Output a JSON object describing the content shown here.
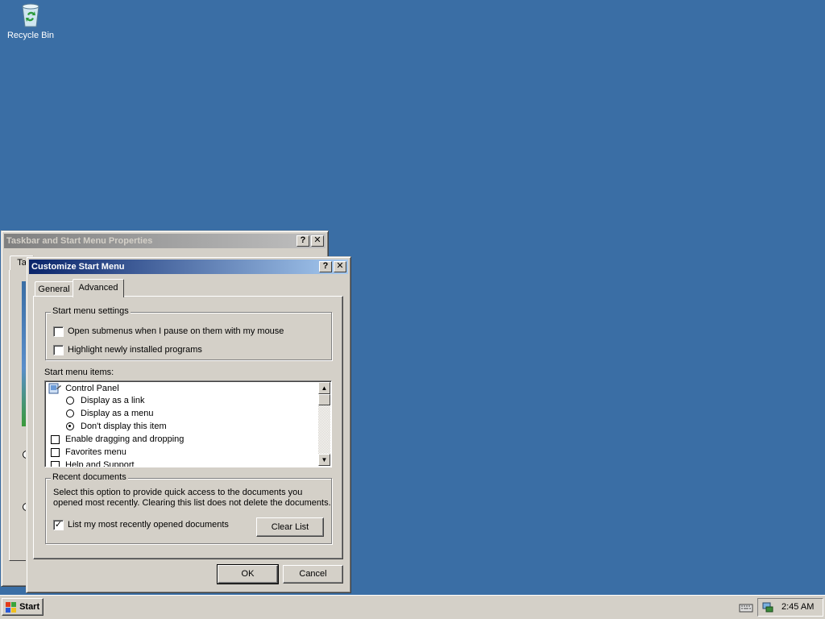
{
  "desktop": {
    "icons": [
      {
        "label": "Recycle Bin",
        "icon": "recycle-bin-icon"
      }
    ],
    "background_color": "#3a6ea5"
  },
  "back_window": {
    "title": "Taskbar and Start Menu Properties",
    "tab_partial": "Ta"
  },
  "dialog": {
    "title": "Customize Start Menu",
    "help_button": "?",
    "close_button": "✕",
    "tabs": [
      {
        "label": "General",
        "selected": false
      },
      {
        "label": "Advanced",
        "selected": true
      }
    ],
    "start_menu_settings": {
      "legend": "Start menu settings",
      "options": [
        {
          "label": "Open submenus when I pause on them with my mouse",
          "checked": false
        },
        {
          "label": "Highlight newly installed programs",
          "checked": false
        }
      ]
    },
    "start_menu_items": {
      "label": "Start menu items:",
      "items": [
        {
          "type": "header",
          "label": "Control Panel",
          "icon": "control-panel-icon"
        },
        {
          "type": "radio",
          "label": "Display as a link",
          "selected": false
        },
        {
          "type": "radio",
          "label": "Display as a menu",
          "selected": false
        },
        {
          "type": "radio",
          "label": "Don't display this item",
          "selected": true
        },
        {
          "type": "checkbox",
          "label": "Enable dragging and dropping",
          "checked": false
        },
        {
          "type": "checkbox",
          "label": "Favorites menu",
          "checked": false
        },
        {
          "type": "checkbox",
          "label": "Help and Support",
          "checked": false
        }
      ]
    },
    "recent_documents": {
      "legend": "Recent documents",
      "description_line1": "Select this option to provide quick access to the documents you",
      "description_line2": "opened most recently.  Clearing this list does not delete the documents.",
      "checkbox_label": "List my most recently opened documents",
      "checked": true,
      "clear_button": "Clear List"
    },
    "ok_button": "OK",
    "cancel_button": "Cancel"
  },
  "taskbar": {
    "start_label": "Start",
    "clock": "2:45 AM"
  }
}
